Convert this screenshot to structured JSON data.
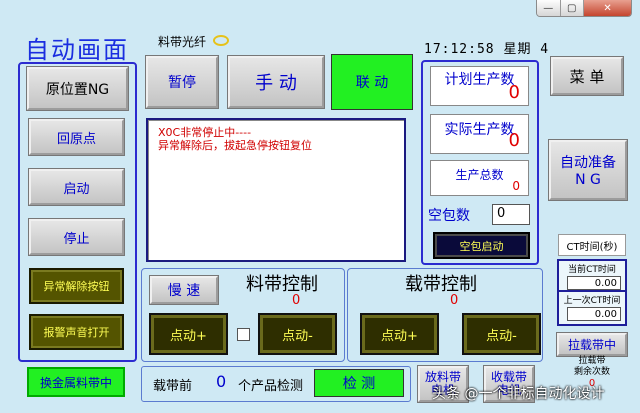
{
  "window": {
    "min": "—",
    "max": "▢",
    "close": "✕"
  },
  "header": {
    "title": "自动画面",
    "fiber_label": "料带光纤",
    "clock": "17:12:58 星期 4"
  },
  "left_panel": {
    "home_status": "原位置NG",
    "home_btn": "回原点",
    "start_btn": "启动",
    "stop_btn": "停止",
    "clear_alarm_btn": "异常解除按钮",
    "alarm_sound_btn": "报警声音打开"
  },
  "mode_buttons": {
    "pause": "暂停",
    "manual": "手 动",
    "link": "联 动"
  },
  "messages": [
    "X0C非常停止中----",
    "异常解除后，拔起急停按钮复位"
  ],
  "production": {
    "planned_label": "计划生产数",
    "planned_value": "0",
    "actual_label": "实际生产数",
    "actual_value": "0",
    "total_label": "生产总数",
    "total_value": "0",
    "empty_label": "空包数",
    "empty_value": "0",
    "empty_start_btn": "空包启动"
  },
  "menu_btn": "菜 单",
  "auto_ready": {
    "line1": "自动准备",
    "line2": "N G"
  },
  "ct": {
    "title": "CT时间(秒)",
    "current_label": "当前CT时间",
    "current_value": "0.00",
    "last_label": "上一次CT时间",
    "last_value": "0.00"
  },
  "tape_control": {
    "slow_btn": "慢 速",
    "title": "料带控制",
    "value": "0",
    "jog_plus": "点动+",
    "jog_minus": "点动-"
  },
  "carrier_control": {
    "title": "载带控制",
    "value": "0",
    "jog_plus": "点动+",
    "jog_minus": "点动-"
  },
  "bottom": {
    "change_tape_btn": "换金属料带中",
    "carrier_front": "载带前",
    "carrier_count": "0",
    "product_detect": "个产品检测",
    "detect_btn": "检 测",
    "release_tape": "放料带",
    "release_tape_sub": "电机",
    "collect_carrier": "收载带",
    "collect_carrier_sub": "电机"
  },
  "pull_carrier": {
    "btn": "拉载带中",
    "label1": "拉载带",
    "label2": "剩余次数",
    "value": "0"
  },
  "watermark": "头条 @一个非标自动化设计"
}
